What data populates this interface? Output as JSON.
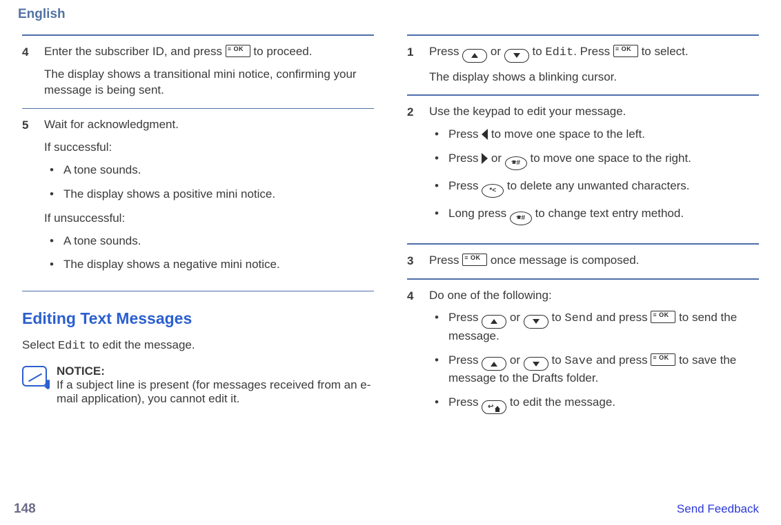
{
  "header": {
    "language": "English"
  },
  "left_column": {
    "step4": {
      "num": "4",
      "line1_a": "Enter the subscriber ID, and press ",
      "line1_b": " to proceed.",
      "line2": "The display shows a transitional mini notice, confirming your message is being sent."
    },
    "step5": {
      "num": "5",
      "line1": "Wait for acknowledgment.",
      "if_success": "If successful:",
      "success_items": [
        "A tone sounds.",
        "The display shows a positive mini notice."
      ],
      "if_fail": "If unsuccessful:",
      "fail_items": [
        "A tone sounds.",
        "The display shows a negative mini notice."
      ]
    },
    "section_title": "Editing Text Messages",
    "intro_a": "Select ",
    "intro_edit": "Edit",
    "intro_b": " to edit the message.",
    "notice": {
      "title": "NOTICE:",
      "body": "If a subject line is present (for messages received from an e-mail application), you cannot edit it."
    }
  },
  "right_column": {
    "step1": {
      "num": "1",
      "a": "Press ",
      "b": " or ",
      "c": " to ",
      "edit": "Edit",
      "d": ". Press ",
      "e": " to select.",
      "line2": "The display shows a blinking cursor."
    },
    "step2": {
      "num": "2",
      "line1": "Use the keypad to edit your message.",
      "b1a": "Press ",
      "b1b": " to move one space to the left.",
      "b2a": "Press ",
      "b2b": " or ",
      "b2c": " to move one space to the right.",
      "b3a": "Press ",
      "b3b": " to delete any unwanted characters.",
      "b4a": "Long press ",
      "b4b": " to change text entry method."
    },
    "step3": {
      "num": "3",
      "a": "Press ",
      "b": " once message is composed."
    },
    "step4": {
      "num": "4",
      "line1": "Do one of the following:",
      "b1a": "Press ",
      "b1b": " or ",
      "b1c": " to ",
      "b1_send": "Send",
      "b1d": " and press ",
      "b1e": " to send the message.",
      "b2a": "Press ",
      "b2b": " or ",
      "b2c": " to ",
      "b2_save": "Save",
      "b2d": " and press ",
      "b2e": " to save the message to the Drafts folder.",
      "b3a": "Press ",
      "b3b": " to edit the message."
    }
  },
  "icons": {
    "ok": "menu-ok",
    "up": "up-arrow",
    "down": "down-arrow",
    "left": "left-solid",
    "right": "right-solid",
    "hash": "hash-key",
    "star": "star-key",
    "back": "back-home"
  },
  "footer": {
    "page": "148",
    "feedback": "Send Feedback"
  }
}
